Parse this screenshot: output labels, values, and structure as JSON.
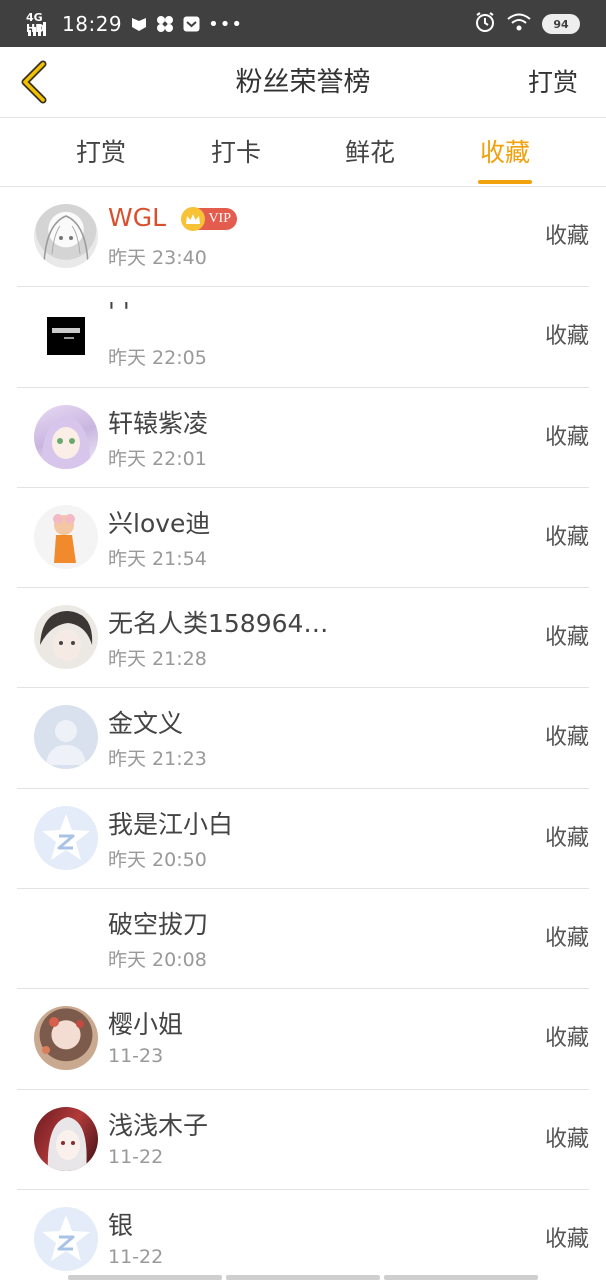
{
  "status_bar": {
    "network": "4G HD",
    "time": "18:29",
    "battery": "94"
  },
  "header": {
    "title": "粉丝荣誉榜",
    "action": "打赏"
  },
  "tabs": [
    {
      "label": "打赏",
      "active": false
    },
    {
      "label": "打卡",
      "active": false
    },
    {
      "label": "鲜花",
      "active": false
    },
    {
      "label": "收藏",
      "active": true
    }
  ],
  "colors": {
    "accent": "#f0a10c",
    "vip_name": "#d9502e"
  },
  "fans": [
    {
      "name": "WGL",
      "time": "昨天 23:40",
      "action": "收藏",
      "vip": "VIP",
      "avatar": "sketch-girl"
    },
    {
      "name": "' '",
      "time": "昨天 22:05",
      "action": "收藏",
      "avatar": "black-square"
    },
    {
      "name": "轩辕紫凌",
      "time": "昨天 22:01",
      "action": "收藏",
      "avatar": "anime-purple"
    },
    {
      "name": "兴love迪",
      "time": "昨天 21:54",
      "action": "收藏",
      "avatar": "orange-child"
    },
    {
      "name": "无名人类158964…",
      "time": "昨天 21:28",
      "action": "收藏",
      "avatar": "dark-hair-boy"
    },
    {
      "name": "金文义",
      "time": "昨天 21:23",
      "action": "收藏",
      "avatar": "default-person"
    },
    {
      "name": "我是江小白",
      "time": "昨天 20:50",
      "action": "收藏",
      "avatar": "star-logo"
    },
    {
      "name": "破空拔刀",
      "time": "昨天 20:08",
      "action": "收藏",
      "avatar": "blank"
    },
    {
      "name": "樱小姐",
      "time": "11-23",
      "action": "收藏",
      "avatar": "painted-woman"
    },
    {
      "name": "浅浅木子",
      "time": "11-22",
      "action": "收藏",
      "avatar": "red-anime"
    },
    {
      "name": "银",
      "time": "11-22",
      "action": "收藏",
      "avatar": "star-logo"
    }
  ]
}
